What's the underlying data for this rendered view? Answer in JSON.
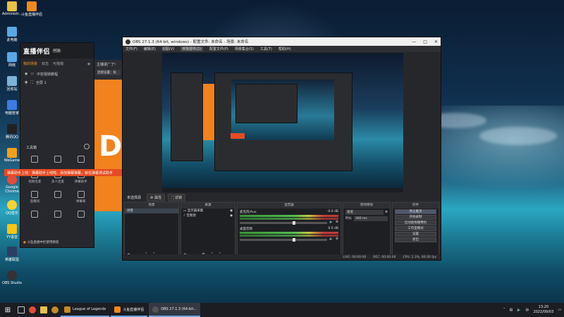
{
  "desktop": {
    "icons": [
      {
        "label": "Administr...",
        "icon": "user-folder-icon",
        "color": "#e8c14a"
      },
      {
        "label": "斗鱼直播伴侣",
        "icon": "douyu-companion-icon",
        "color": "#f08a1e"
      },
      {
        "label": "此电脑",
        "icon": "computer-icon",
        "color": "#5aa7e6"
      },
      {
        "label": "网络",
        "icon": "network-icon",
        "color": "#5aa7e6"
      },
      {
        "label": "回收站",
        "icon": "recycle-bin-icon",
        "color": "#7fb2d8"
      },
      {
        "label": "电脑管家",
        "icon": "pc-manager-icon",
        "color": "#3d7be0"
      },
      {
        "label": "腾讯QQ",
        "icon": "qq-icon",
        "color": "#222222"
      },
      {
        "label": "WeGame",
        "icon": "wegame-icon",
        "color": "#f0a020"
      },
      {
        "label": "Google Chrome",
        "icon": "chrome-icon",
        "color": "#e24b3a"
      },
      {
        "label": "QQ音乐",
        "icon": "qq-music-icon",
        "color": "#f3d33a"
      },
      {
        "label": "YY语音",
        "icon": "yy-icon",
        "color": "#f5c518"
      },
      {
        "label": "英雄联盟",
        "icon": "lol-icon",
        "color": "#2b3e63"
      },
      {
        "label": "OBS Studio",
        "icon": "obs-icon",
        "color": "#333333"
      }
    ]
  },
  "companion": {
    "logo": "直播伴侣",
    "badge": "PC版",
    "tabs": [
      "我的场景",
      "双击",
      "可拖拽"
    ],
    "add_label": "+",
    "scenes": [
      "中控视频教程",
      "全屏 1"
    ],
    "tools_title": "工具箱",
    "tools": [
      "",
      "",
      "",
      "视频连麦",
      "多人连麦",
      "弹幕助手",
      "直播间",
      "",
      "弹幕库",
      "",
      "",
      ""
    ],
    "footer": "斗鱼直播中控使用教程",
    "banner": "弹幕助手上线：弹幕助手上线啦，添加弹幕弹幕，就在弹幕测试助手"
  },
  "stream": {
    "heading": "主播进厂了!",
    "sub": "连接设置：标",
    "big_letter": "D"
  },
  "obs": {
    "title": "OBS 27.1.3 (64-bit, windows) - 配置文件: 未命名 - 场景: 未命名",
    "window_buttons": [
      "—",
      "□",
      "✕"
    ],
    "menu": [
      "文件(F)",
      "编辑(E)",
      "视图(V)",
      "停靠部件(D)",
      "配置文件(P)",
      "场景集合(S)",
      "工具(T)",
      "帮助(H)"
    ],
    "mode_label": "未选择源",
    "mode_buttons": [
      "⚙ 属性",
      "⛶ 滤镜"
    ],
    "panels": {
      "scenes": {
        "header": "场景",
        "items": [
          "场景"
        ],
        "footer": "+ − ˄ ˅"
      },
      "sources": {
        "header": "来源",
        "items": [
          "显示器采集",
          "音频源"
        ],
        "footer": "+ − ⚙ ˄ ˅"
      },
      "mixer": {
        "header": "混音器",
        "tracks": [
          {
            "name": "麦克风/Aux",
            "db": "-0.0 dB"
          },
          {
            "name": "桌面音频",
            "db": "0.0 dB"
          }
        ]
      },
      "transitions": {
        "header": "转场特效",
        "type": "渐变",
        "duration_label": "时长",
        "duration": "300 ms"
      },
      "controls": {
        "header": "控件",
        "buttons": [
          "停止推流",
          "开始录制",
          "启动虚拟摄像机",
          "工作室模式",
          "设置",
          "退出"
        ],
        "active_index": 0
      }
    },
    "status": [
      "LIVE: 00:00:00",
      "REC: 00:00:00",
      "CPU: 2.3%, 60.00 fps"
    ]
  },
  "taskbar": {
    "start_icon": "windows-start-icon",
    "pinned": [
      {
        "icon": "chrome-icon",
        "color": "#e24b3a"
      },
      {
        "icon": "folder-icon",
        "color": "#e8c14a"
      },
      {
        "icon": "lol-icon",
        "color": "#c48a2b"
      }
    ],
    "items": [
      {
        "label": "League of Legends",
        "color": "#c48a2b",
        "active": false
      },
      {
        "label": "斗鱼直播伴侣",
        "color": "#f08a1e",
        "active": false
      },
      {
        "label": "OBS 27.1.3 (64-bit...",
        "color": "#555555",
        "active": true
      }
    ],
    "time": "13:20",
    "date": "2022/09/03",
    "ime": "中"
  }
}
